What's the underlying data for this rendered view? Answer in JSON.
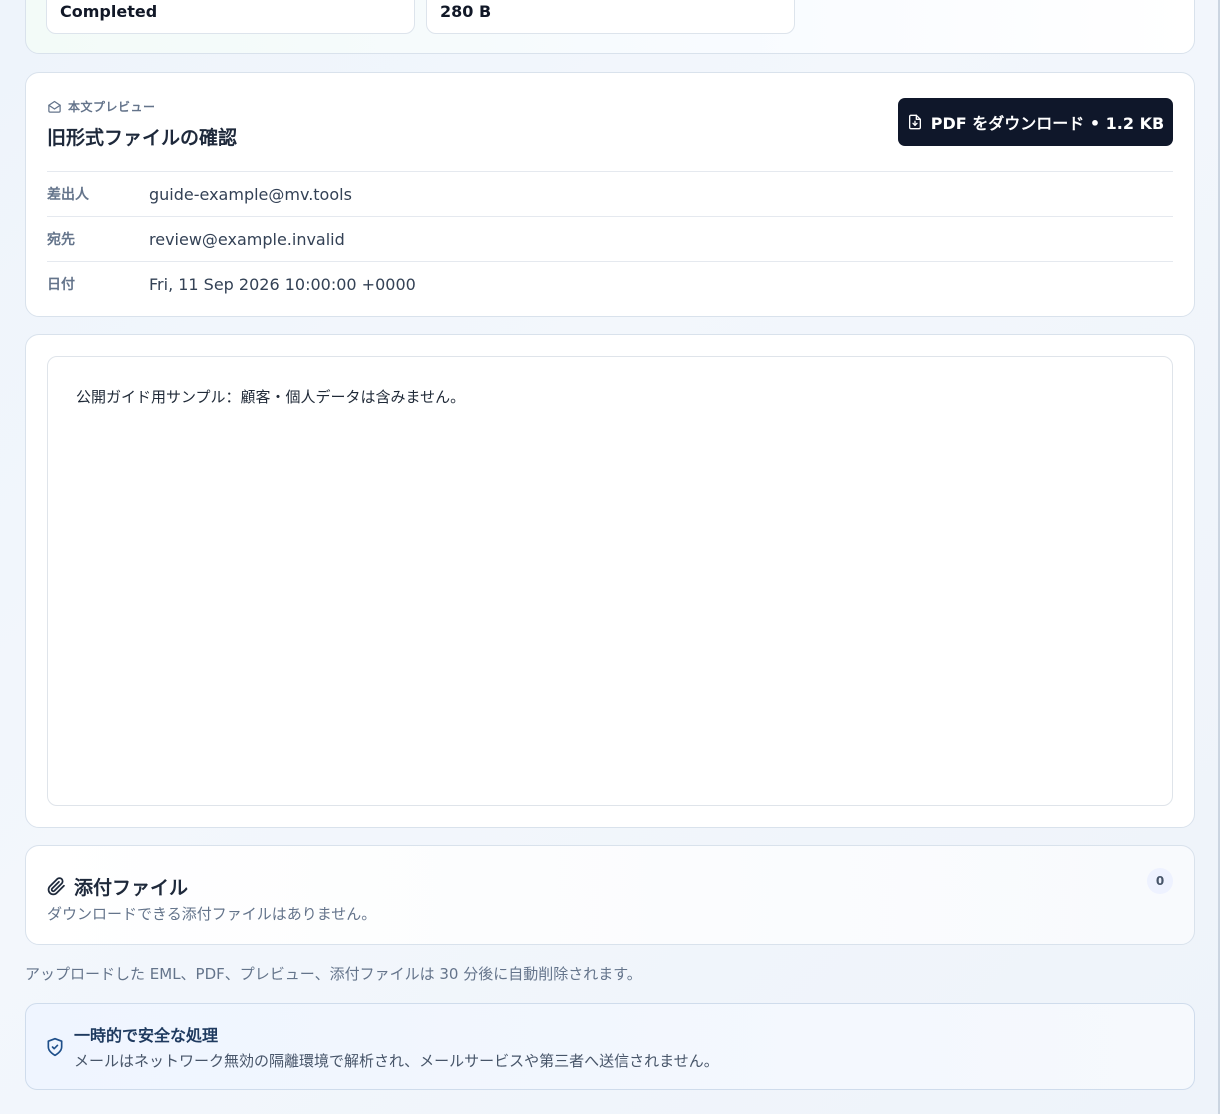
{
  "stats": {
    "status_value": "Completed",
    "size_value": "280 B"
  },
  "preview": {
    "eyebrow_label": "本文プレビュー",
    "eyebrow_icon": "mail-open-icon",
    "subject": "旧形式ファイルの確認",
    "download_button_label": "PDF をダウンロード • 1.2 KB",
    "download_icon": "file-download-icon",
    "meta": [
      {
        "key": "差出人",
        "value": "guide-example@mv.tools"
      },
      {
        "key": "宛先",
        "value": "review@example.invalid"
      },
      {
        "key": "日付",
        "value": "Fri, 11 Sep 2026 10:00:00 +0000"
      }
    ]
  },
  "body": {
    "text": "公開ガイド用サンプル：顧客・個人データは含みません。"
  },
  "attachments": {
    "title": "添付ファイル",
    "icon": "paperclip-icon",
    "empty_message": "ダウンロードできる添付ファイルはありません。",
    "count": "0"
  },
  "auto_delete_note": "アップロードした EML、PDF、プレビュー、添付ファイルは 30 分後に自動削除されます。",
  "notice": {
    "icon": "shield-check-icon",
    "title": "一時的で安全な処理",
    "text": "メールはネットワーク無効の隔離環境で解析され、メールサービスや第三者へ送信されません。"
  },
  "colors": {
    "primary_button": "#0f172a",
    "muted_text": "#64748b",
    "notice_bg": "#eff5ff"
  }
}
